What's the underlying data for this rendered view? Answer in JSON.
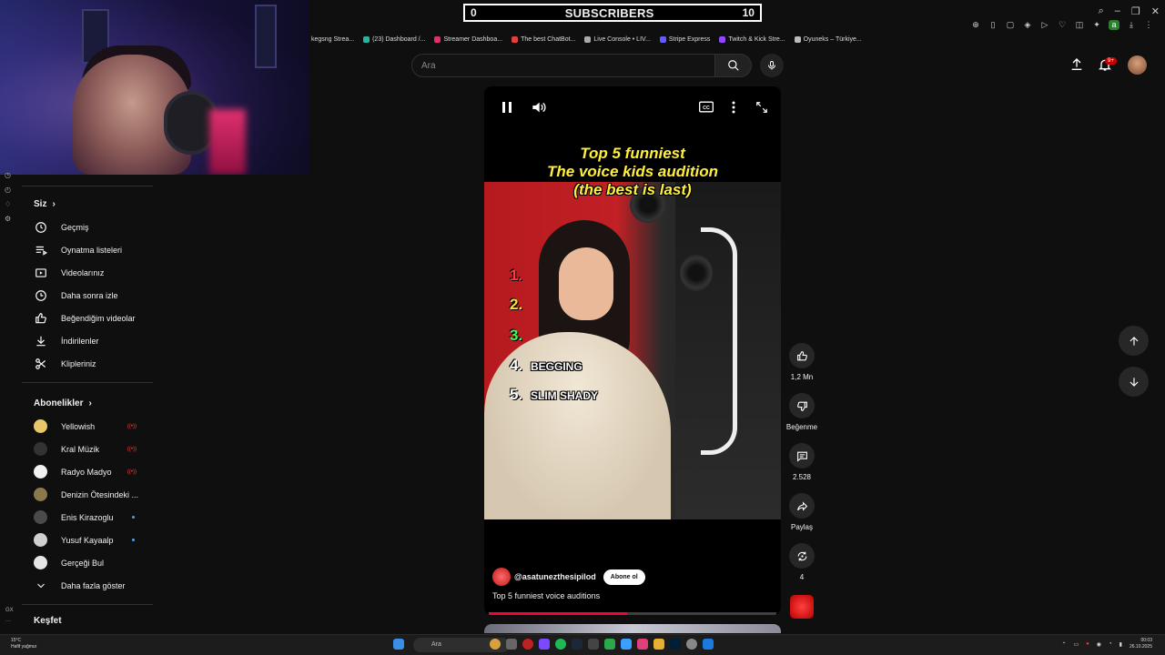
{
  "overlay": {
    "subs_current": "0",
    "subs_label": "SUBSCRIBERS",
    "subs_goal": "10"
  },
  "bookmarks": [
    "kegsng Strea...",
    "(23) Dashboard /...",
    "Streamer Dashboa...",
    "The best ChatBot...",
    "Live Console • LIV...",
    "Stripe Express",
    "Twitch & Kick Stre...",
    "Oyuneks – Türkiye..."
  ],
  "header": {
    "search_placeholder": "Ara",
    "notif_badge": "9+"
  },
  "sidebar": {
    "you_heading": "Siz",
    "you_items": [
      {
        "label": "Geçmiş",
        "icon": "history-icon"
      },
      {
        "label": "Oynatma listeleri",
        "icon": "playlist-icon"
      },
      {
        "label": "Videolarınız",
        "icon": "your-videos-icon"
      },
      {
        "label": "Daha sonra izle",
        "icon": "watch-later-icon"
      },
      {
        "label": "Beğendiğim videolar",
        "icon": "liked-icon"
      },
      {
        "label": "İndirilenler",
        "icon": "download-icon"
      },
      {
        "label": "Klipleriniz",
        "icon": "scissors-icon"
      }
    ],
    "subs_heading": "Abonelikler",
    "subscriptions": [
      {
        "name": "Yellowish",
        "status": "live",
        "color": "#e8c66a"
      },
      {
        "name": "Kral Müzik",
        "status": "live",
        "color": "#333333"
      },
      {
        "name": "Radyo Madyo",
        "status": "live",
        "color": "#f2f2f2"
      },
      {
        "name": "Denizin Ötesindeki ...",
        "status": "none",
        "color": "#8a7a4a"
      },
      {
        "name": "Enis Kirazoglu",
        "status": "new",
        "color": "#4a4a4a"
      },
      {
        "name": "Yusuf Kayaalp",
        "status": "new",
        "color": "#d0d0d0"
      },
      {
        "name": "Gerçeği Bul",
        "status": "none",
        "color": "#e6e6e6"
      }
    ],
    "show_more": "Daha fazla göster",
    "explore_heading": "Keşfet"
  },
  "player": {
    "caption_lines": [
      "Top 5 funniest",
      "The voice kids audition",
      "(the best is last)"
    ],
    "ranks": [
      {
        "num": "1.",
        "text": "",
        "color": "#ff3b3b"
      },
      {
        "num": "2.",
        "text": "",
        "color": "#ffe03a"
      },
      {
        "num": "3.",
        "text": "",
        "color": "#3aff5a"
      },
      {
        "num": "4.",
        "text": "BEGGING",
        "color": "#ffffff"
      },
      {
        "num": "5.",
        "text": "SLIM SHADY",
        "color": "#ffffff"
      }
    ],
    "channel": "@asatunezthesipilod",
    "subscribe_label": "Abone ol",
    "title": "Top 5 funniest voice auditions",
    "progress": 0.48
  },
  "actions": {
    "likes": "1,2 Mn",
    "dislike_label": "Beğenme",
    "comments": "2.528",
    "share_label": "Paylaş",
    "remix_count": "4"
  },
  "taskbar": {
    "weather_temp": "15°C",
    "weather_desc": "Hafif yağmur",
    "search_placeholder": "Ara",
    "time": "00:03",
    "date": "26.10.2025"
  }
}
